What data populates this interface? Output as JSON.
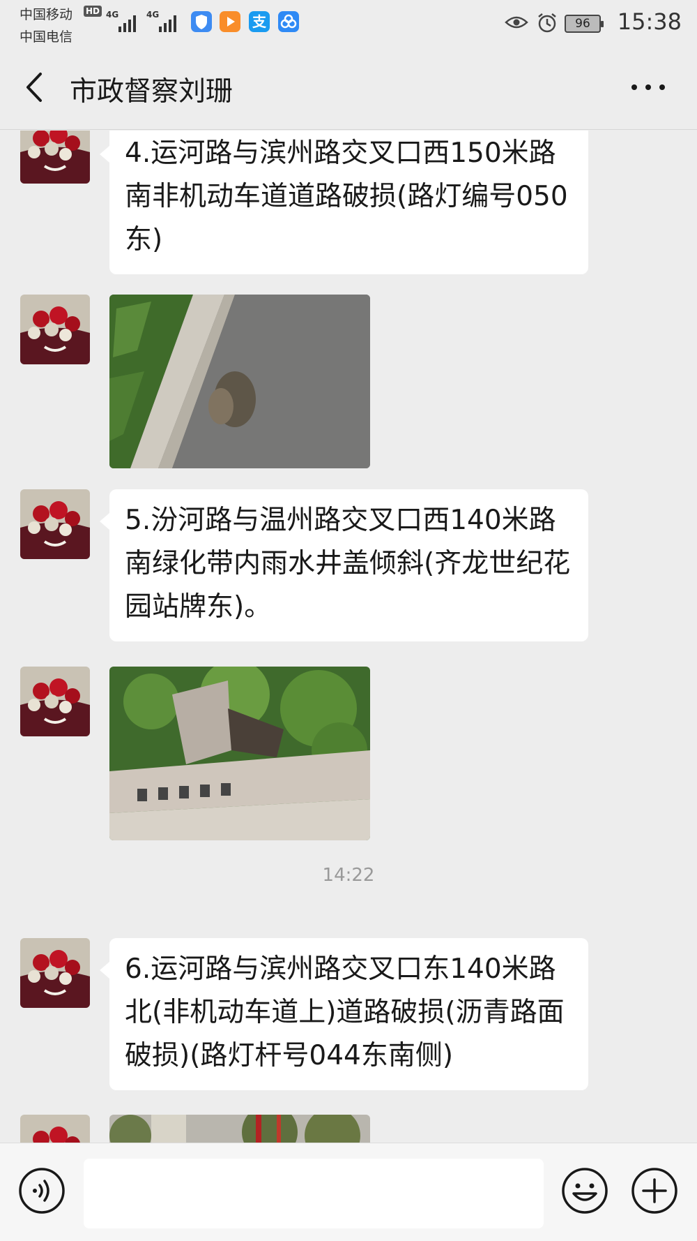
{
  "status_bar": {
    "carrier_1": "中国移动",
    "carrier_1_badge": "HD",
    "carrier_2": "中国电信",
    "network_1": "4G",
    "network_2": "4G",
    "battery": "96",
    "time": "15:38",
    "app_icons": [
      "shield-icon",
      "play-icon",
      "alipay-icon",
      "clover-icon"
    ]
  },
  "header": {
    "title": "市政督察刘珊"
  },
  "messages": [
    {
      "type": "text",
      "text": "4.运河路与滨州路交叉口西150米路南非机动车道道路破损(路灯编号050东)"
    },
    {
      "type": "image",
      "description_icon": "road-photo"
    },
    {
      "type": "text",
      "text": "5.汾河路与温州路交叉口西140米路南绿化带内雨水井盖倾斜(齐龙世纪花园站牌东)。"
    },
    {
      "type": "image",
      "description_icon": "manhole-photo"
    },
    {
      "type": "time",
      "text": "14:22"
    },
    {
      "type": "text",
      "text": "6.运河路与滨州路交叉口东140米路北(非机动车道上)道路破损(沥青路面破损)(路灯杆号044东南侧)"
    },
    {
      "type": "image",
      "description_icon": "street-photo"
    }
  ],
  "bottom_bar": {
    "input_value": "",
    "input_placeholder": ""
  },
  "colors": {
    "background": "#ededed",
    "bubble": "#ffffff",
    "text": "#191919",
    "timestamp": "#999999"
  }
}
